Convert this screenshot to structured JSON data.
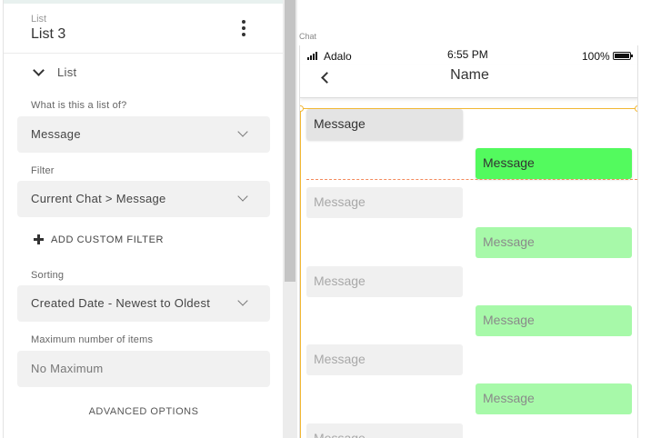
{
  "panel": {
    "header_caption": "List",
    "header_title": "List 3",
    "section_label": "List",
    "list_of_label": "What is this a list of?",
    "list_of_value": "Message",
    "filter_label": "Filter",
    "filter_value": "Current Chat > Message",
    "add_filter_label": "ADD CUSTOM FILTER",
    "sorting_label": "Sorting",
    "sorting_value": "Created Date - Newest to Oldest",
    "max_items_label": "Maximum number of items",
    "max_items_placeholder": "No Maximum",
    "advanced_label": "ADVANCED OPTIONS"
  },
  "canvas": {
    "screen_label": "Chat",
    "status": {
      "carrier": "Adalo",
      "time": "6:55 PM",
      "battery": "100%"
    },
    "nav_title": "Name",
    "messages": [
      {
        "side": "in",
        "text": "Message",
        "ghost": false
      },
      {
        "side": "out",
        "text": "Message",
        "ghost": false
      },
      {
        "side": "in",
        "text": "Message",
        "ghost": true
      },
      {
        "side": "out",
        "text": "Message",
        "ghost": true
      },
      {
        "side": "in",
        "text": "Message",
        "ghost": true
      },
      {
        "side": "out",
        "text": "Message",
        "ghost": true
      },
      {
        "side": "in",
        "text": "Message",
        "ghost": true
      },
      {
        "side": "out",
        "text": "Message",
        "ghost": true
      },
      {
        "side": "in",
        "text": "Message",
        "ghost": true
      }
    ]
  },
  "colors": {
    "selection": "#f2b733",
    "separator": "#f48a5b",
    "outgoing_bubble": "#53fa5e",
    "incoming_bubble": "#e4e4e4"
  },
  "icons": [
    "kebab-icon",
    "chevron-down-icon",
    "plus-icon",
    "back-chevron-icon",
    "signal-icon",
    "battery-icon"
  ]
}
